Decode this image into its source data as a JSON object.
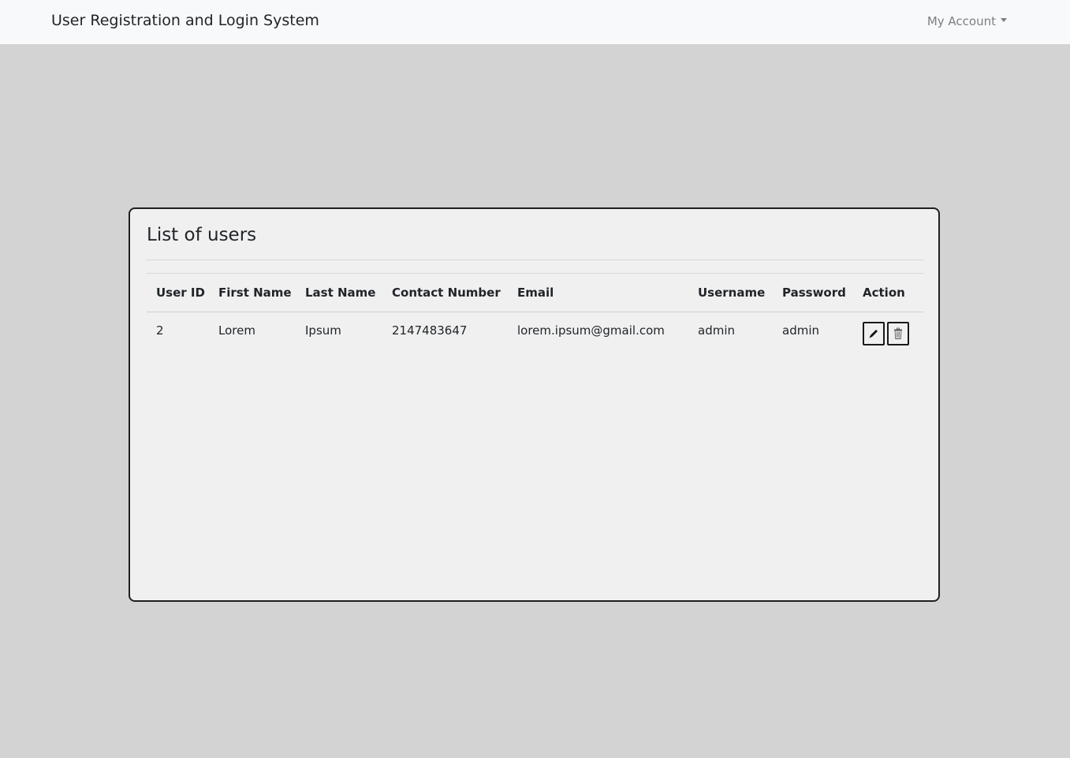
{
  "navbar": {
    "brand": "User Registration and Login System",
    "account_label": "My Account"
  },
  "card": {
    "title": "List of users"
  },
  "table": {
    "headers": [
      "User ID",
      "First Name",
      "Last Name",
      "Contact Number",
      "Email",
      "Username",
      "Password",
      "Action"
    ],
    "rows": [
      {
        "user_id": "2",
        "first_name": "Lorem",
        "last_name": "Ipsum",
        "contact": "2147483647",
        "email": "lorem.ipsum@gmail.com",
        "username": "admin",
        "password": "admin"
      }
    ]
  },
  "icons": {
    "edit": "pencil-icon",
    "delete": "trash-icon"
  }
}
